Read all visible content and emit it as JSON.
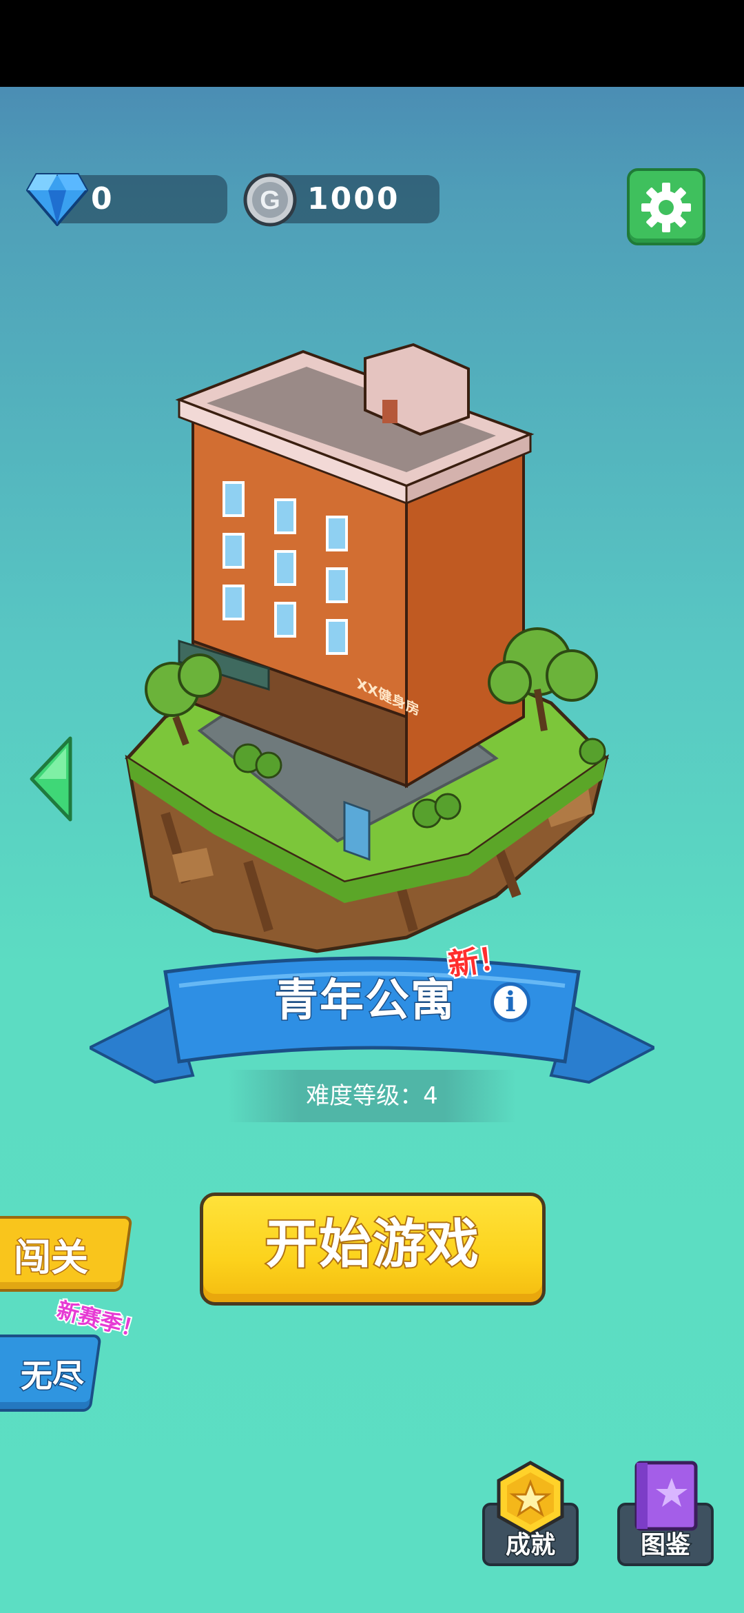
{
  "resources": {
    "gems": "0",
    "coins": "1000",
    "gem_icon": "diamond-icon",
    "coin_icon": "coin-g-icon"
  },
  "settings": {
    "icon": "gear-icon"
  },
  "level": {
    "title": "青年公寓",
    "new_badge": "新！",
    "sign_text": "XX健身房",
    "difficulty": "难度等级：4"
  },
  "modes": {
    "level_mode": "闯关",
    "endless_mode": "无尽",
    "season_badge": "新赛季！"
  },
  "actions": {
    "start": "开始游戏"
  },
  "bottom_nav": {
    "achievements": "成就",
    "collection": "图鉴"
  },
  "colors": {
    "accent_green": "#3fc05d",
    "start_yellow": "#fcd21c",
    "ribbon_blue": "#2e8fe4",
    "background_teal": "#5cdec3"
  }
}
